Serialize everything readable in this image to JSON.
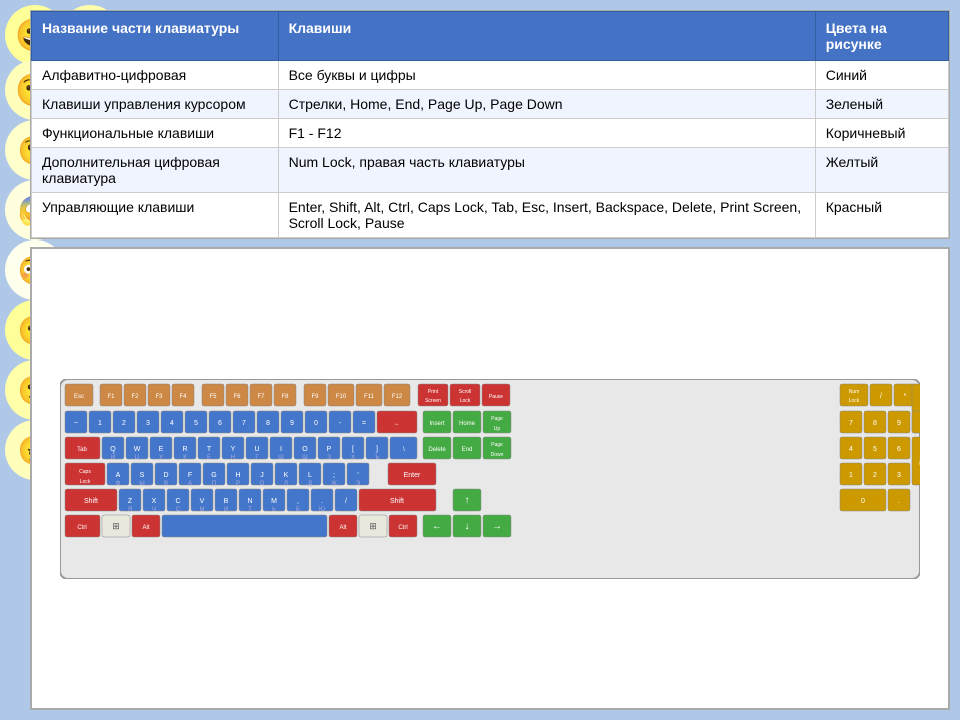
{
  "background": {
    "color": "#b0c8e8"
  },
  "table": {
    "headers": [
      "Название части клавиатуры",
      "Клавиши",
      "Цвета на рисунке"
    ],
    "rows": [
      {
        "part": "Алфавитно-цифровая",
        "keys": "Все буквы и цифры",
        "color": "Синий"
      },
      {
        "part": "Клавиши управления курсором",
        "keys": "Стрелки, Home, End, Page Up, Page Down",
        "color": "Зеленый"
      },
      {
        "part": "Функциональные клавиши",
        "keys": "F1 - F12",
        "color": "Коричневый"
      },
      {
        "part": "Дополнительная цифровая клавиатура",
        "keys": "Num Lock, правая часть клавиатуры",
        "color": "Желтый"
      },
      {
        "part": "Управляющие клавиши",
        "keys": "Enter, Shift, Alt, Ctrl, Caps Lock, Tab, Esc, Insert, Backspace, Delete, Print Screen, Scroll Lock, Pause",
        "color": "Красный"
      }
    ]
  }
}
